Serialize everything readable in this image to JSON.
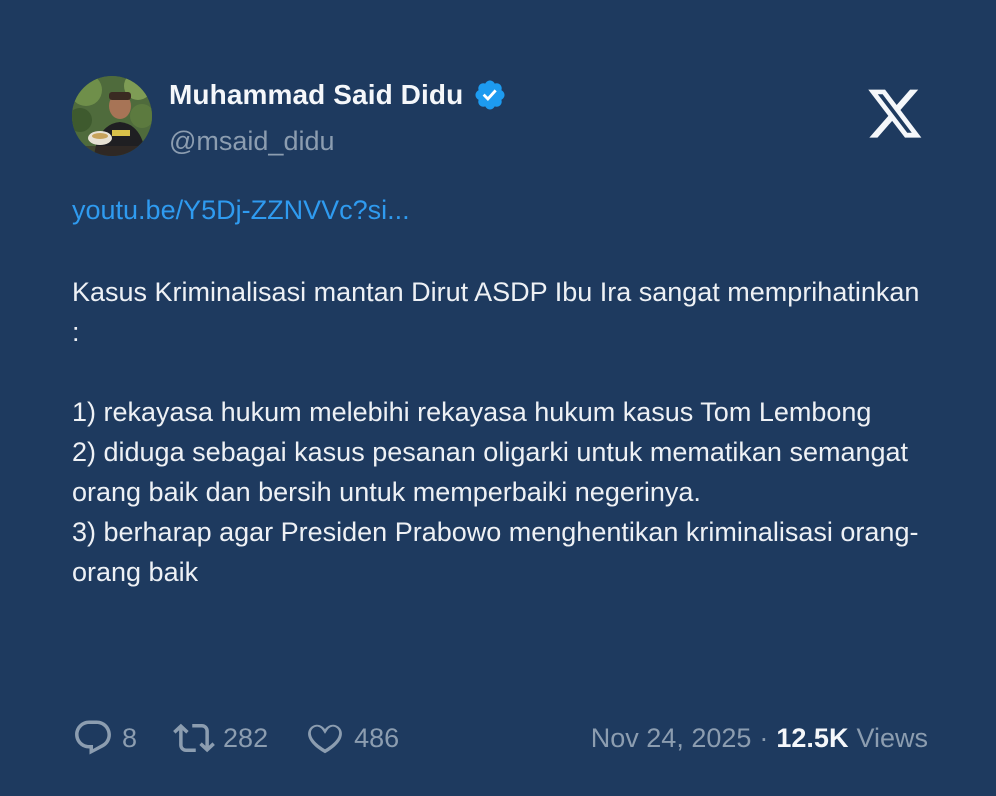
{
  "author": {
    "name": "Muhammad Said Didu",
    "handle": "@msaid_didu",
    "verified_icon": "verified-badge-icon",
    "avatar_icon": "avatar"
  },
  "platform_icon": "x-logo-icon",
  "tweet": {
    "link_text": "youtu.be/Y5Dj-ZZNVVc?si...",
    "paragraphs": [
      "Kasus Kriminalisasi mantan Dirut ASDP Ibu Ira sangat memprihatinkan :",
      "",
      "1) rekayasa hukum melebihi rekayasa hukum kasus Tom Lembong",
      "2) diduga sebagai kasus pesanan oligarki untuk mematikan semangat orang baik dan bersih untuk memperbaiki negerinya.",
      "3) berharap agar Presiden Prabowo menghentikan kriminalisasi orang-orang baik"
    ]
  },
  "actions": {
    "replies": "8",
    "reposts": "282",
    "likes": "486"
  },
  "meta": {
    "date": "Nov 24, 2025",
    "separator": "·",
    "views_count": "12.5K",
    "views_label": "Views"
  },
  "colors": {
    "background": "#1e3a5f",
    "link": "#2f9bf0",
    "verified": "#1d9bf0",
    "muted": "#8c9db0",
    "text": "#eef1f5"
  }
}
